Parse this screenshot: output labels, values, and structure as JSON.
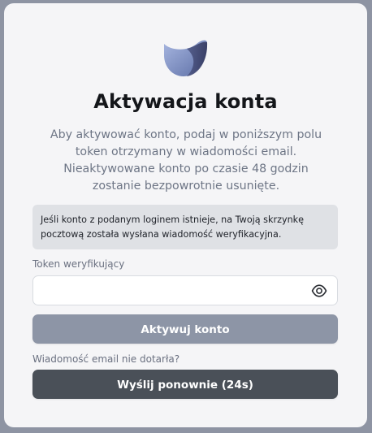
{
  "heading": {
    "title": "Aktywacja konta",
    "description_lines": [
      "Aby aktywować konto, podaj w poniższym polu",
      "token otrzymany w wiadomości email.",
      "Nieaktywowane konto po czasie 48 godzin",
      "zostanie bezpowrotnie usunięte."
    ]
  },
  "alert": {
    "lines": [
      "Jeśli konto z podanym loginem istnieje, na Twoją skrzynkę",
      "pocztową została wysłana wiadomość weryfikacyjna."
    ]
  },
  "token_field": {
    "label": "Token weryfikujący",
    "value": "",
    "placeholder": "",
    "toggle_icon": "eye-icon"
  },
  "actions": {
    "activate_label": "Aktywuj konto",
    "resend_prompt": "Wiadomość email nie dotarła?",
    "resend_label": "Wyślij ponownie (24s)"
  },
  "logo": {
    "icon": "brand-logo-icon",
    "colors": [
      "#8ea2d6",
      "#5b6fa8",
      "#3a3f6a"
    ]
  },
  "colors": {
    "page_background": "#8e94a3",
    "card_background": "#f5f5f7",
    "alert_background": "#dfe1e5",
    "activate_button": "#8d95a6",
    "resend_button": "#4a5058"
  }
}
